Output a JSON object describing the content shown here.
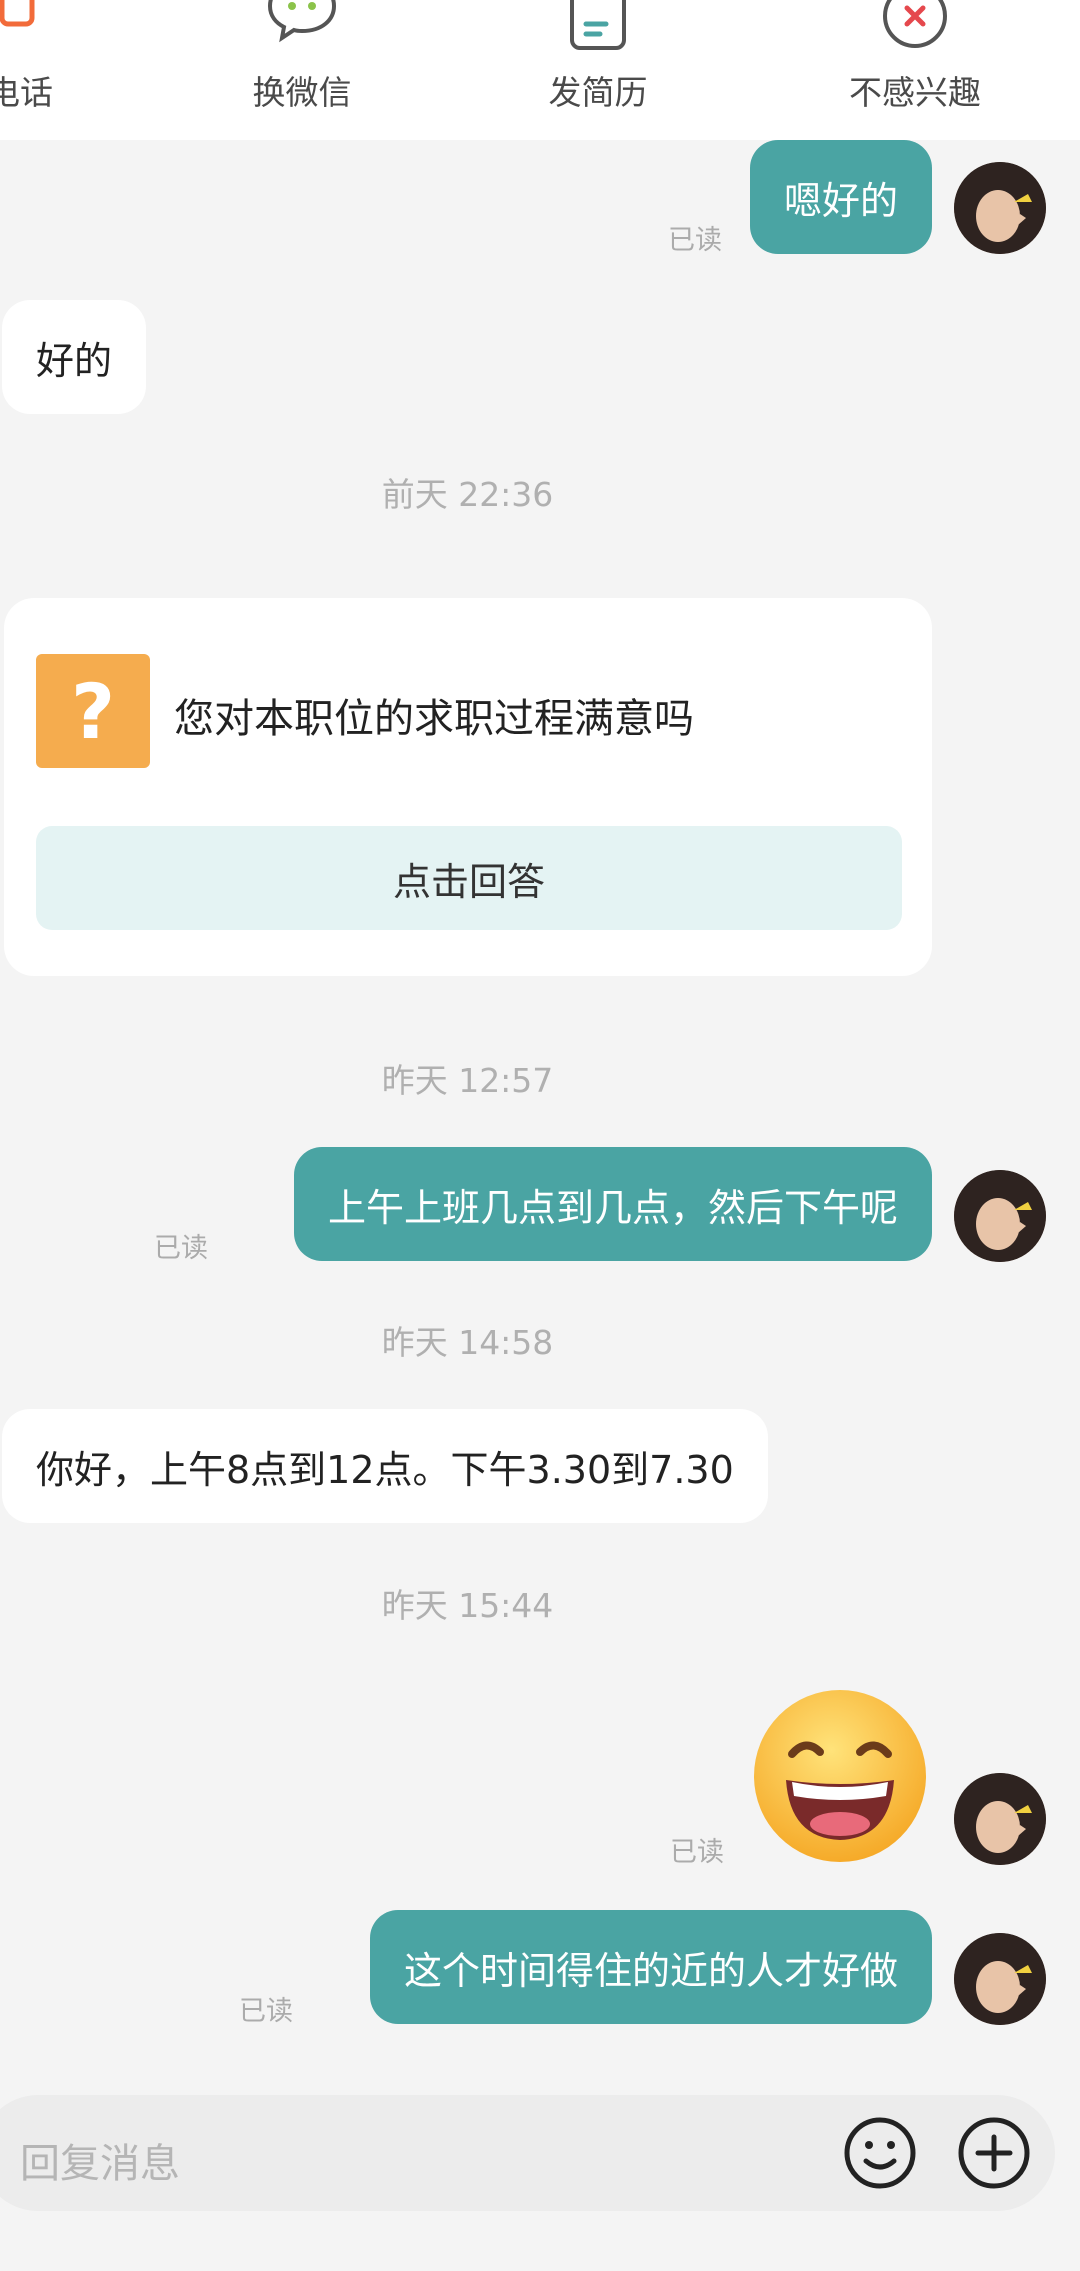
{
  "actions": {
    "call_label": "电话",
    "wechat_label": "换微信",
    "resume_label": "发简历",
    "not_interested_label": "不感兴趣"
  },
  "messages": [
    {
      "type": "out",
      "text": "嗯好的",
      "status": "已读"
    },
    {
      "type": "in",
      "text": "好的"
    },
    {
      "type": "time",
      "text": "前天 22:36"
    },
    {
      "type": "survey",
      "question": "您对本职位的求职过程满意吗",
      "button": "点击回答"
    },
    {
      "type": "time",
      "text": "昨天 12:57"
    },
    {
      "type": "out",
      "text": "上午上班几点到几点，然后下午呢",
      "status": "已读"
    },
    {
      "type": "time",
      "text": "昨天 14:58"
    },
    {
      "type": "in",
      "text": "你好，上午8点到12点。下午3.30到7.30"
    },
    {
      "type": "time",
      "text": "昨天 15:44"
    },
    {
      "type": "sticker",
      "name": "grinning-face-emoji",
      "status": "已读"
    },
    {
      "type": "out",
      "text": "这个时间得住的近的人才好做",
      "status": "已读"
    }
  ],
  "input": {
    "placeholder": "回复消息"
  },
  "colors": {
    "accent": "#4aa4a3",
    "survey_icon": "#f5ac4e",
    "survey_button_bg": "#e4f3f3",
    "call_icon": "#f26b3a",
    "wechat_icon": "#8bc34a",
    "resume_icon": "#4aa4a3",
    "not_interested_icon": "#e5484d"
  },
  "icons": {
    "call": "phone-icon",
    "wechat": "wechat-icon",
    "resume": "resume-icon",
    "not_interested": "close-circle-icon",
    "emoji": "smiley-icon",
    "plus": "plus-circle-icon"
  }
}
